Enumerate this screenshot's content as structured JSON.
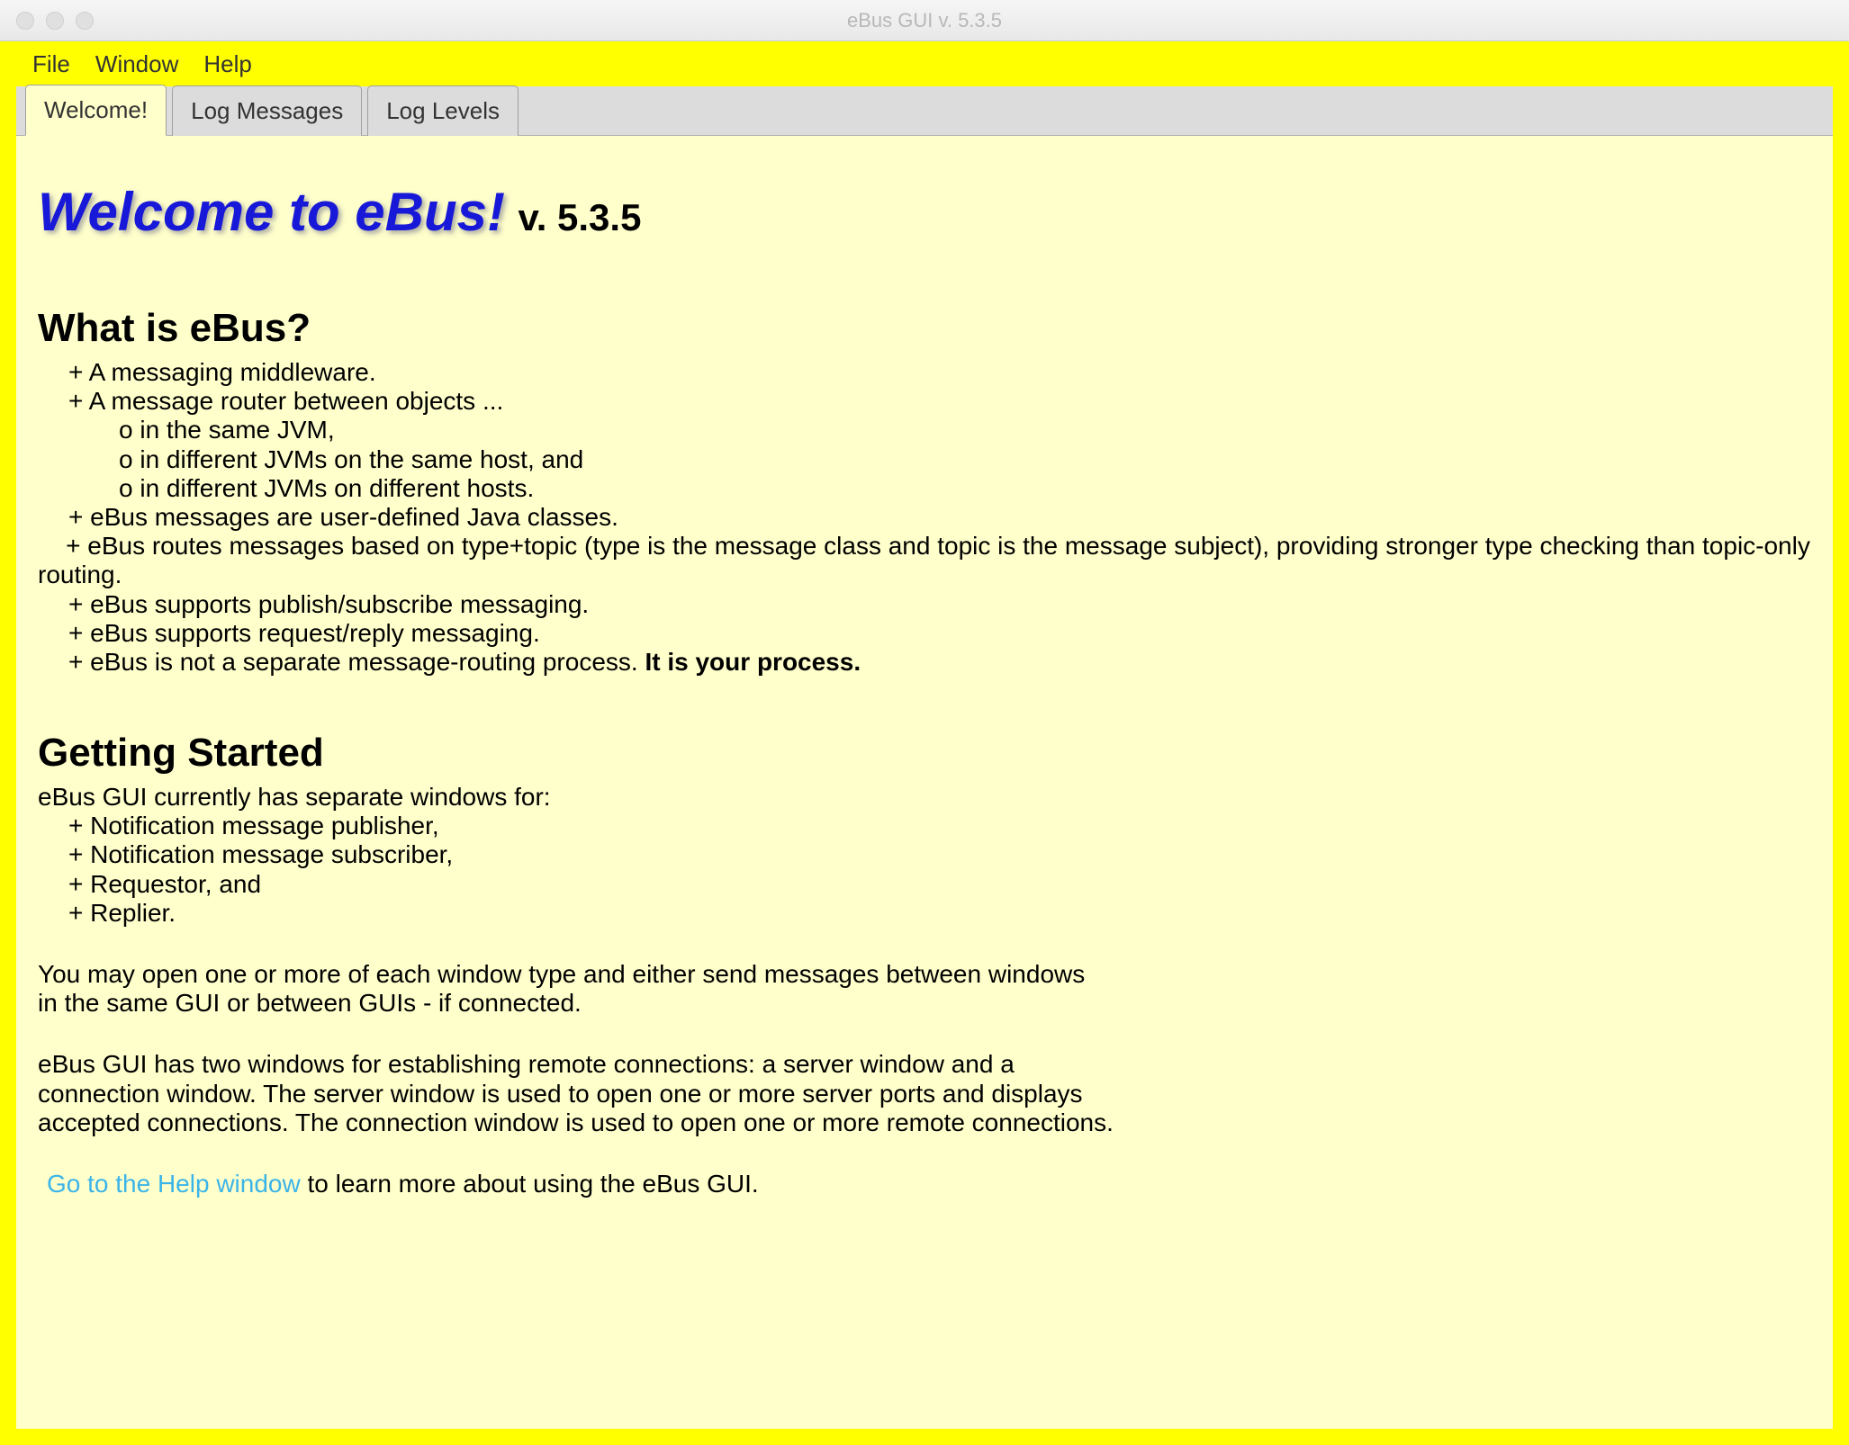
{
  "window": {
    "title": "eBus GUI v. 5.3.5"
  },
  "menubar": {
    "file": "File",
    "window": "Window",
    "help": "Help"
  },
  "tabs": {
    "welcome": "Welcome!",
    "log_messages": "Log Messages",
    "log_levels": "Log Levels"
  },
  "hero": {
    "welcome_title": "Welcome to eBus!",
    "version": "v. 5.3.5"
  },
  "section1": {
    "heading": "What is eBus?",
    "li1": "+ A messaging middleware.",
    "li2": "+ A message router between objects ...",
    "li2a": "o in the same JVM,",
    "li2b": "o in different JVMs on the same host, and",
    "li2c": "o in different JVMs on different hosts.",
    "li3": "+ eBus messages are user-defined Java classes.",
    "li4": "    + eBus routes messages based on type+topic (type is the message class and topic is the message subject), providing stronger type checking than topic-only routing.",
    "li5": "+ eBus supports publish/subscribe messaging.",
    "li6": "+ eBus supports request/reply messaging.",
    "li7_pre": "+ eBus is not a separate message-routing process. ",
    "li7_bold": "It is your process."
  },
  "section2": {
    "heading": "Getting Started",
    "intro": "eBus GUI currently has separate windows for:",
    "li1": "+ Notification message publisher,",
    "li2": "+ Notification message subscriber,",
    "li3": "+ Requestor, and",
    "li4": "+ Replier.",
    "p1a": "You may open one or more of each window type and either send messages between windows",
    "p1b": "in the same GUI or between GUIs - if connected.",
    "p2a": "eBus GUI has two windows for establishing remote connections: a server window and a",
    "p2b": "connection window. The server window is used to open one or more server ports and displays",
    "p2c": "accepted connections. The connection window is used to open one or more remote connections.",
    "link_text": "Go to the Help window",
    "link_suffix": "  to learn more about using the eBus GUI."
  }
}
